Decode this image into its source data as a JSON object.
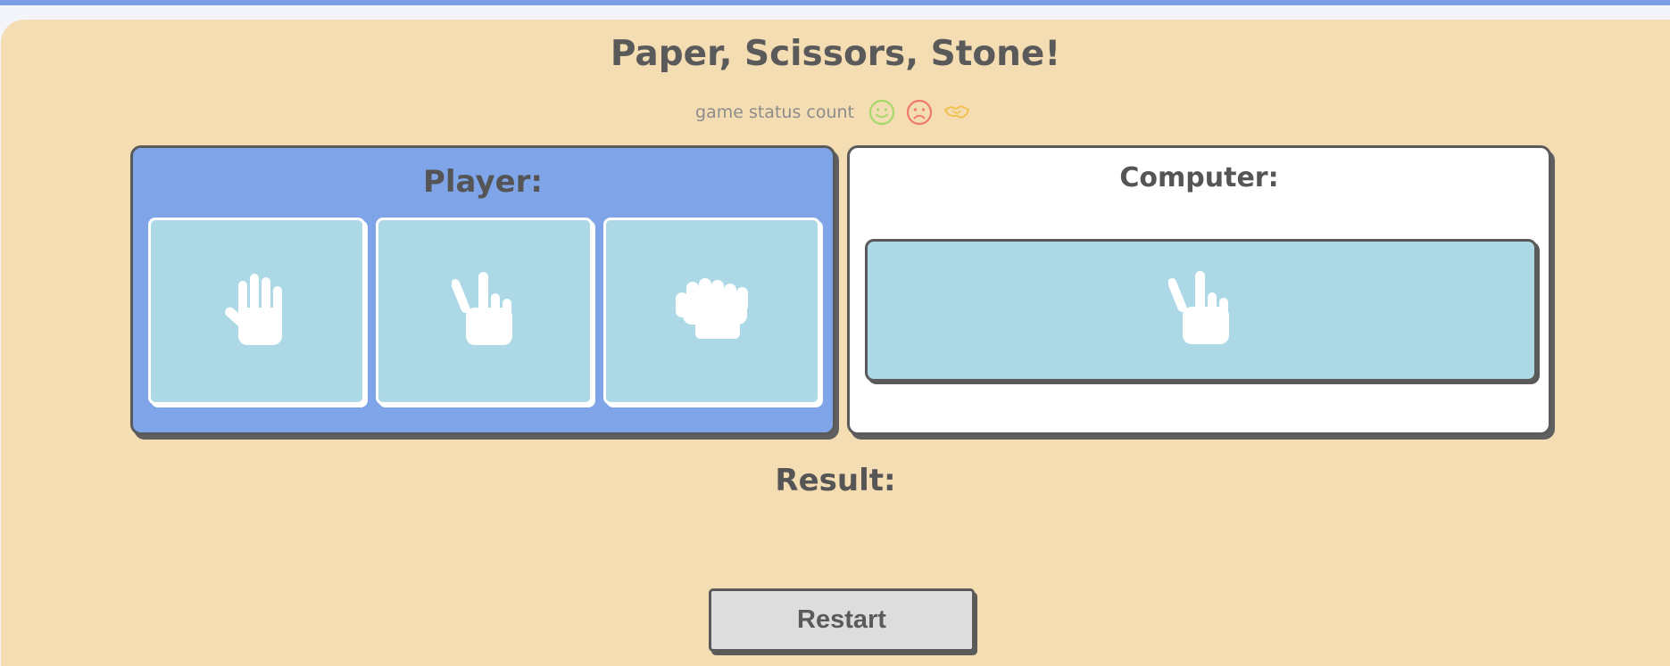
{
  "app": {
    "title": "Paper, Scissors, Stone!"
  },
  "status": {
    "label": "game status count",
    "icons": [
      "smile-icon",
      "frown-icon",
      "handshake-icon"
    ],
    "colors": {
      "win": "#a6d96a",
      "lose": "#ef7b6b",
      "draw": "#f2c14e"
    }
  },
  "player": {
    "title": "Player:",
    "choices": [
      {
        "name": "paper",
        "icon": "hand-open-icon"
      },
      {
        "name": "scissors",
        "icon": "hand-peace-icon"
      },
      {
        "name": "stone",
        "icon": "hand-fist-icon"
      }
    ]
  },
  "computer": {
    "title": "Computer:",
    "choice": {
      "name": "scissors",
      "icon": "hand-peace-icon"
    }
  },
  "result": {
    "label": "Result:",
    "value": ""
  },
  "controls": {
    "restart_label": "Restart"
  },
  "colors": {
    "background": "#f4ddb3",
    "player_panel": "#7fa5e8",
    "computer_panel": "#ffffff",
    "card": "#add8e6",
    "accent_bar": "#7b9fe6",
    "button": "#dddddd"
  }
}
